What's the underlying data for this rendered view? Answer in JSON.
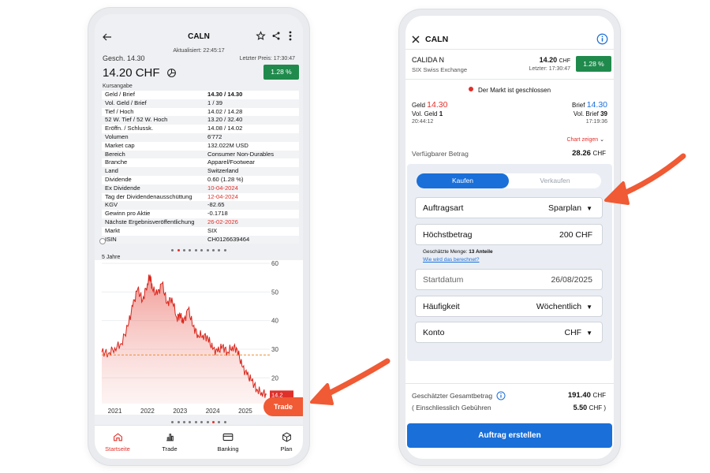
{
  "left_phone": {
    "header": {
      "title": "CALN",
      "updated": "Aktualisiert: 22:45:17"
    },
    "quote": {
      "gesch": "Gesch. 14.30",
      "last_price_time": "Letzter Preis: 17:30:47",
      "price": "14.20 CHF",
      "change": "1.28 %"
    },
    "section_label": "Kursangabe",
    "rows": [
      {
        "k": "Geld / Brief",
        "v": "14.30 / 14.30",
        "bold": true
      },
      {
        "k": "Vol. Geld / Brief",
        "v": "1 / 39"
      },
      {
        "k": "Tief / Hoch",
        "v": "14.02 / 14.28"
      },
      {
        "k": "52 W. Tief / 52 W. Hoch",
        "v": "13.20 / 32.40"
      },
      {
        "k": "Eröffn. / Schlussk.",
        "v": "14.08 / 14.02"
      },
      {
        "k": "Volumen",
        "v": "6'772"
      },
      {
        "k": "Market cap",
        "v": "132.022M USD"
      },
      {
        "k": "Bereich",
        "v": "Consumer Non-Durables"
      },
      {
        "k": "Branche",
        "v": "Apparel/Footwear"
      },
      {
        "k": "Land",
        "v": "Switzerland"
      },
      {
        "k": "Dividende",
        "v": "0.60 (1.28 %)"
      },
      {
        "k": "Ex Dividende",
        "v": "10-04-2024",
        "red": true
      },
      {
        "k": "Tag der Dividendenausschüttung",
        "v": "12-04-2024",
        "red": true
      },
      {
        "k": "KGV",
        "v": "-82.65"
      },
      {
        "k": "Gewinn pro Aktie",
        "v": "-0.1718"
      },
      {
        "k": "Nächste Ergebnisveröffentlichung",
        "v": "26-02-2026",
        "red": true
      },
      {
        "k": "Markt",
        "v": "SIX"
      },
      {
        "k": "ISIN",
        "v": "CH0126639464"
      }
    ],
    "chart_period": "5 Jahre",
    "trade_button": "Trade",
    "bottom_nav": [
      "Startseite",
      "Trade",
      "Banking",
      "Plan"
    ]
  },
  "chart_data": {
    "type": "area",
    "title": "",
    "xlabel": "",
    "ylabel": "",
    "x_ticks": [
      "2021",
      "2022",
      "2023",
      "2024",
      "2025"
    ],
    "y_ticks": [
      20,
      30,
      40,
      50,
      60
    ],
    "ylim": [
      11,
      60
    ],
    "reference_line": 28.0,
    "last_value_label": "14.2",
    "series": [
      {
        "x": [
          2020.6,
          2020.8,
          2021.0,
          2021.2,
          2021.4,
          2021.55,
          2021.7,
          2021.85,
          2022.0,
          2022.08,
          2022.15,
          2022.3,
          2022.45,
          2022.6,
          2022.75,
          2022.9,
          2023.0,
          2023.1,
          2023.25,
          2023.4,
          2023.55,
          2023.7,
          2023.85,
          2024.0,
          2024.15,
          2024.3,
          2024.45,
          2024.6,
          2024.75,
          2024.9,
          2025.05,
          2025.2,
          2025.35,
          2025.5,
          2025.65
        ],
        "y": [
          29.0,
          28.5,
          30.5,
          32.0,
          38.0,
          45.0,
          51.0,
          47.0,
          53.0,
          56.0,
          51.0,
          49.0,
          53.0,
          46.0,
          48.0,
          41.0,
          42.0,
          39.0,
          44.0,
          38.0,
          35.0,
          35.0,
          34.0,
          30.0,
          29.0,
          31.0,
          29.0,
          31.0,
          30.0,
          24.0,
          21.0,
          19.0,
          16.0,
          15.0,
          14.2
        ]
      }
    ]
  },
  "right_phone": {
    "header": {
      "title": "CALN"
    },
    "instrument": {
      "name": "CALIDA N",
      "price": "14.20",
      "currency": "CHF",
      "exchange": "SIX Swiss Exchange",
      "last_price": "Letzter: 17:30:47",
      "change": "1.28 %"
    },
    "market_status": "Der Markt ist geschlossen",
    "bid": {
      "label": "Geld",
      "value": "14.30",
      "vol_label": "Vol. Geld",
      "vol_value": "1",
      "time": "20:44:12"
    },
    "ask": {
      "label": "Brief",
      "value": "14.30",
      "vol_label": "Vol. Brief",
      "vol_value": "39",
      "time": "17:19:36"
    },
    "chart_toggle": "Chart zeigen",
    "available": {
      "label": "Verfügbarer Betrag",
      "value": "28.26",
      "currency": "CHF"
    },
    "tabs": {
      "buy": "Kaufen",
      "sell": "Verkaufen"
    },
    "form": {
      "order_type": {
        "label": "Auftragsart",
        "value": "Sparplan"
      },
      "max_amount": {
        "label": "Höchstbetrag",
        "value": "200 CHF"
      },
      "estimate": {
        "text": "Geschätzte Menge:",
        "value": "13 Anteile",
        "link": "Wie wird das berechnet?"
      },
      "start_date": {
        "label": "Startdatum",
        "value": "26/08/2025"
      },
      "frequency": {
        "label": "Häufigkeit",
        "value": "Wöchentlich"
      },
      "account": {
        "label": "Konto",
        "value": "CHF"
      }
    },
    "summary": {
      "total_label": "Geschätzter Gesamtbetrag",
      "total_value": "191.40",
      "total_currency": "CHF",
      "fees_label": "( Einschliesslich Gebühren",
      "fees_value": "5.50",
      "fees_currency": "CHF )"
    },
    "submit_button": "Auftrag erstellen"
  },
  "colors": {
    "accent_blue": "#1a6fd8",
    "green": "#1f8a4c",
    "red": "#e0302a",
    "orange_arrow": "#f05a34"
  }
}
